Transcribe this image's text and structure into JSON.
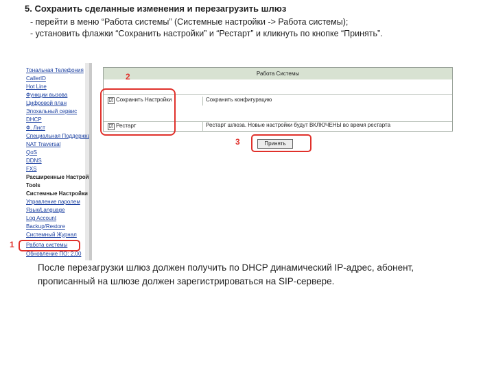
{
  "document": {
    "heading": "5. Сохранить сделанные изменения и перезагрузить шлюз",
    "step_line_1": "- перейти в меню “Работа системы” (Системные настройки -> Работа системы);",
    "step_line_2": "- установить флажки “Сохранить настройки” и “Рестарт” и кликнуть по кнопке “Принять”.",
    "note_line_1": "После перезагрузки шлюз должен получить по DHCP динамический IP-адрес, абонент,",
    "note_line_2": "прописанный на шлюзе должен зарегистрироваться на SIP-сервере."
  },
  "screenshot": {
    "menu": [
      {
        "label": "Тональная Телефония",
        "type": "link"
      },
      {
        "label": "CallerID",
        "type": "link"
      },
      {
        "label": "Hot Line",
        "type": "link"
      },
      {
        "label": "Функции вызова",
        "type": "link"
      },
      {
        "label": "Цифровой план",
        "type": "link"
      },
      {
        "label": "Эпохальный сервис",
        "type": "link"
      },
      {
        "label": "DHCP",
        "type": "link"
      },
      {
        "label": "Ф. Лист",
        "type": "link"
      },
      {
        "label": "Специальная Поддержка",
        "type": "link"
      },
      {
        "label": "NAT Traversal",
        "type": "link"
      },
      {
        "label": "QoS",
        "type": "link"
      },
      {
        "label": "DDNS",
        "type": "link"
      },
      {
        "label": "FXS",
        "type": "link"
      },
      {
        "label": "Расширенные Настройки",
        "type": "section"
      },
      {
        "label": "Tools",
        "type": "section"
      },
      {
        "label": "Системные Настройки",
        "type": "section"
      },
      {
        "label": "Управление паролем",
        "type": "link"
      },
      {
        "label": "Язык/Language",
        "type": "link"
      },
      {
        "label": "Log Account",
        "type": "link"
      },
      {
        "label": "Backup/Restore",
        "type": "link"
      },
      {
        "label": "Системный Журнал",
        "type": "link"
      },
      {
        "label": "Работа системы",
        "type": "link"
      },
      {
        "label": "Обновление ПО: 2.00",
        "type": "link"
      }
    ],
    "table_header": "Работа Системы",
    "rows": [
      {
        "checkbox": "☑",
        "label": "Сохранить Настройки",
        "description": "Сохранить конфигурацию"
      },
      {
        "checkbox": "☑",
        "label": "Рестарт",
        "description": "Рестарт шлюза. Новые настройки будут ВКЛЮЧЕНЫ во время рестарта"
      }
    ],
    "apply_label": "Принять",
    "callouts": [
      "1",
      "2",
      "3"
    ]
  }
}
